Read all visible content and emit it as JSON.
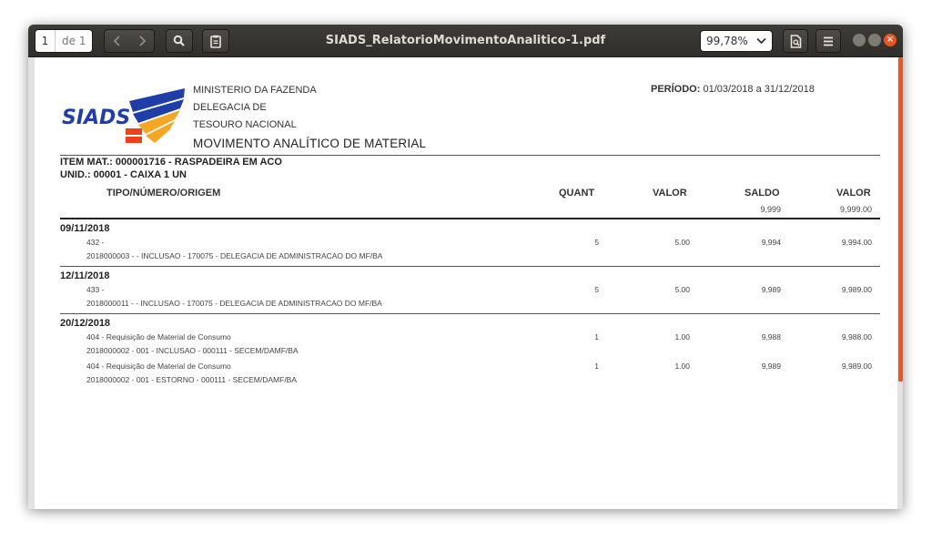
{
  "toolbar": {
    "page_current": "1",
    "page_of": "de 1",
    "doc_title": "SIADS_RelatorioMovimentoAnalitico-1.pdf",
    "zoom": "99,78%"
  },
  "report": {
    "logo_text": "SIADS",
    "header": [
      "MINISTERIO DA FAZENDA",
      "DELEGACIA DE",
      "TESOURO NACIONAL"
    ],
    "title": "MOVIMENTO ANALÍTICO DE MATERIAL",
    "periodo_label": "PERÍODO:",
    "periodo_value": "01/03/2018 a 31/12/2018",
    "item": "ITEM MAT.: 000001716 - RASPADEIRA EM ACO",
    "unid": "UNID.: 00001 - CAIXA 1 UN",
    "columns": {
      "tipo": "TIPO/NÚMERO/ORIGEM",
      "quant": "QUANT",
      "valor": "VALOR",
      "saldo": "SALDO",
      "valor2": "VALOR"
    },
    "opening": {
      "saldo": "9,999",
      "valor": "9,999.00"
    },
    "groups": [
      {
        "date": "09/11/2018",
        "entries": [
          {
            "line1": "432 -",
            "line2": "2018000003 -  - INCLUSAO - 170075 - DELEGACIA DE ADMINISTRACAO DO MF/BA",
            "quant": "5",
            "valor": "5.00",
            "saldo": "9,994",
            "valor2": "9,994.00"
          }
        ]
      },
      {
        "date": "12/11/2018",
        "entries": [
          {
            "line1": "433 -",
            "line2": "2018000011 -  - INCLUSAO - 170075 - DELEGACIA DE ADMINISTRACAO DO MF/BA",
            "quant": "5",
            "valor": "5.00",
            "saldo": "9,989",
            "valor2": "9,989.00"
          }
        ]
      },
      {
        "date": "20/12/2018",
        "entries": [
          {
            "line1": "404 - Requisição de Material de Consumo",
            "line2": "2018000002 - 001 - INCLUSAO - 000111 - SECEM/DAMF/BA",
            "quant": "1",
            "valor": "1.00",
            "saldo": "9,988",
            "valor2": "9,988.00"
          },
          {
            "line1": "404 - Requisição de Material de Consumo",
            "line2": "2018000002 - 001 - ESTORNO - 000111 - SECEM/DAMF/BA",
            "quant": "1",
            "valor": "1.00",
            "saldo": "9,989",
            "valor2": "9,989.00"
          }
        ]
      }
    ]
  },
  "colors": {
    "accent": "#e95420",
    "logo_blue": "#1f3ea8",
    "logo_orange": "#f5a623",
    "logo_red": "#e8431c"
  },
  "icons": [
    "chevron-left-icon",
    "chevron-right-icon",
    "search-icon",
    "clipboard-icon",
    "chevron-down-icon",
    "print-preview-icon",
    "hamburger-menu-icon"
  ]
}
